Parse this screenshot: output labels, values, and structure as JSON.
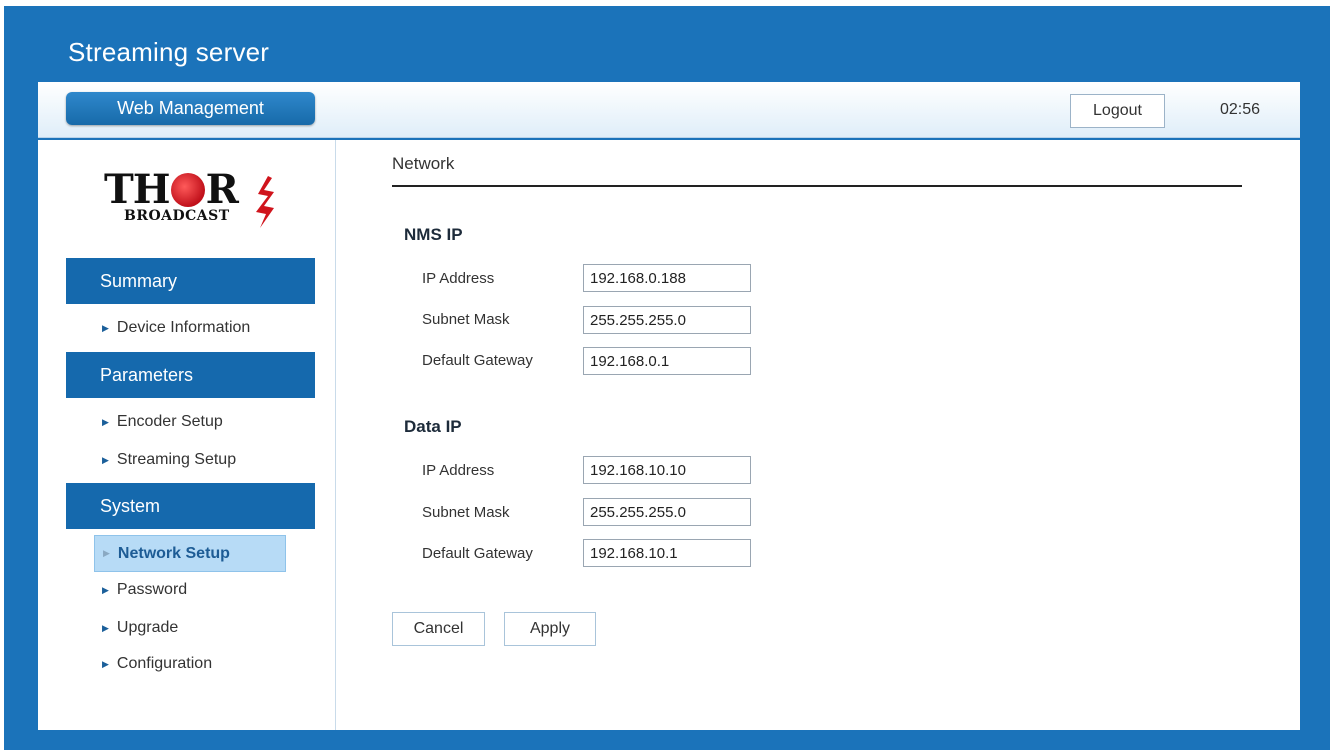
{
  "app": {
    "title": "Streaming server"
  },
  "toolbar": {
    "web_management": "Web Management",
    "logout": "Logout",
    "clock": "02:56"
  },
  "logo": {
    "letters_before": "TH",
    "letters_after": "R",
    "subtitle": "BROADCAST"
  },
  "sidebar": {
    "sections": [
      {
        "label": "Summary",
        "items": [
          {
            "label": "Device Information"
          }
        ]
      },
      {
        "label": "Parameters",
        "items": [
          {
            "label": "Encoder Setup"
          },
          {
            "label": "Streaming Setup"
          }
        ]
      },
      {
        "label": "System",
        "items": [
          {
            "label": "Network Setup",
            "active": true
          },
          {
            "label": "Password"
          },
          {
            "label": "Upgrade"
          },
          {
            "label": "Configuration"
          }
        ]
      }
    ]
  },
  "main": {
    "title": "Network",
    "nms": {
      "title": "NMS IP",
      "ip_label": "IP Address",
      "ip_value": "192.168.0.188",
      "mask_label": "Subnet Mask",
      "mask_value": "255.255.255.0",
      "gateway_label": "Default Gateway",
      "gateway_value": "192.168.0.1"
    },
    "data": {
      "title": "Data IP",
      "ip_label": "IP Address",
      "ip_value": "192.168.10.10",
      "mask_label": "Subnet Mask",
      "mask_value": "255.255.255.0",
      "gateway_label": "Default Gateway",
      "gateway_value": "192.168.10.1"
    },
    "buttons": {
      "cancel": "Cancel",
      "apply": "Apply"
    }
  },
  "colors": {
    "brand_blue": "#1b73ba",
    "section_blue": "#1569ad",
    "active_item_bg": "#b7dbf6",
    "logo_red": "#d0141c"
  },
  "icons": {
    "nav_arrow": "right-triangle-icon"
  }
}
